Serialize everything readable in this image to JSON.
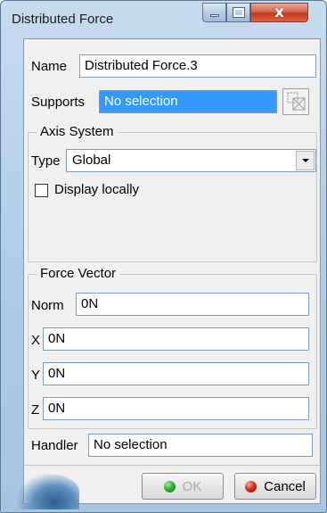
{
  "window": {
    "title": "Distributed Force",
    "close_glyph": "x"
  },
  "name_row": {
    "label": "Name",
    "value": "Distributed Force.3"
  },
  "supports_row": {
    "label": "Supports",
    "value": "No selection",
    "icon": "multi-select-icon"
  },
  "axis_system": {
    "title": "Axis System",
    "type_label": "Type",
    "type_value": "Global",
    "display_locally_label": "Display locally",
    "display_locally_checked": false
  },
  "force_vector": {
    "title": "Force Vector",
    "norm": {
      "label": "Norm",
      "value": "0N"
    },
    "x": {
      "label": "X",
      "value": "0N"
    },
    "y": {
      "label": "Y",
      "value": "0N"
    },
    "z": {
      "label": "Z",
      "value": "0N"
    }
  },
  "handler_row": {
    "label": "Handler",
    "value": "No selection"
  },
  "buttons": {
    "ok_label": "OK",
    "ok_enabled": false,
    "cancel_label": "Cancel"
  },
  "colors": {
    "selection": "#3399ff",
    "ok_dot": "#2fb12f",
    "cancel_dot": "#e02a1a"
  }
}
